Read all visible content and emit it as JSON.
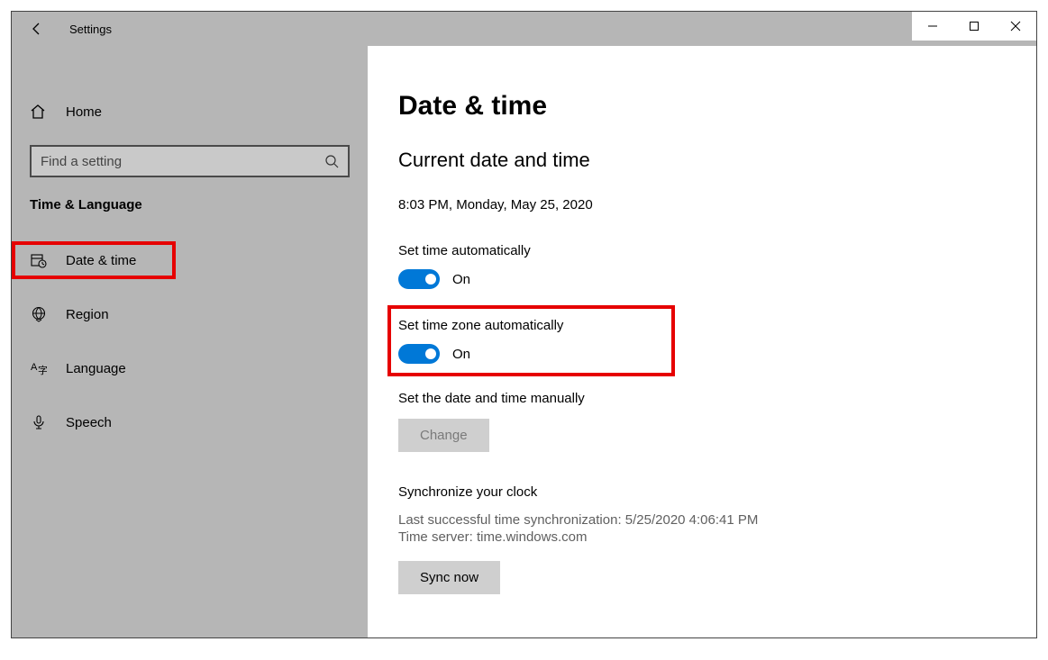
{
  "titlebar": {
    "title": "Settings"
  },
  "sidebar": {
    "home_label": "Home",
    "search_placeholder": "Find a setting",
    "section_header": "Time & Language",
    "items": [
      {
        "label": "Date & time"
      },
      {
        "label": "Region"
      },
      {
        "label": "Language"
      },
      {
        "label": "Speech"
      }
    ]
  },
  "content": {
    "page_title": "Date & time",
    "section_current": "Current date and time",
    "current_datetime": "8:03 PM, Monday, May 25, 2020",
    "set_time_auto_label": "Set time automatically",
    "set_time_auto_state": "On",
    "set_tz_auto_label": "Set time zone automatically",
    "set_tz_auto_state": "On",
    "set_manual_label": "Set the date and time manually",
    "change_button": "Change",
    "sync_header": "Synchronize your clock",
    "sync_last": "Last successful time synchronization: 5/25/2020 4:06:41 PM",
    "sync_server": "Time server: time.windows.com",
    "sync_now_button": "Sync now"
  }
}
